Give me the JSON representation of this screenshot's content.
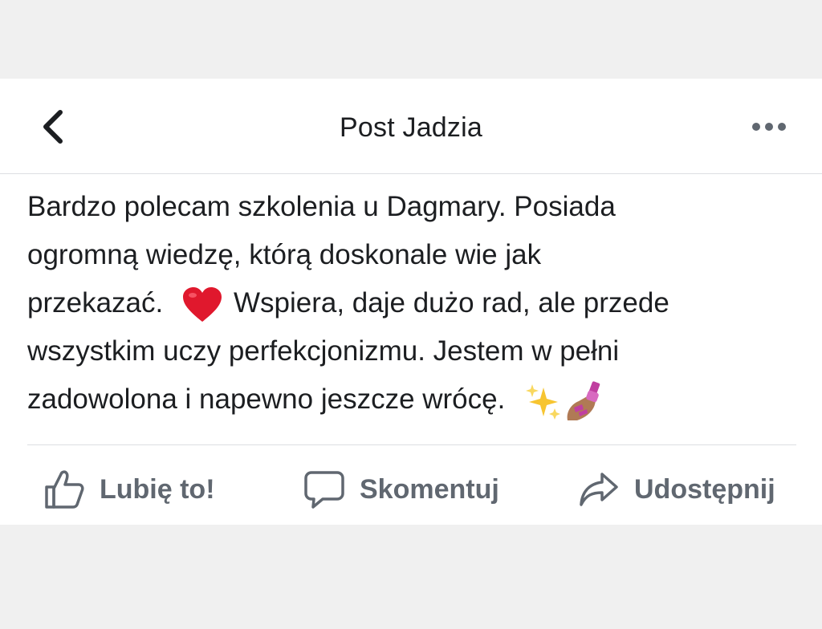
{
  "header": {
    "title": "Post Jadzia",
    "back_icon": "chevron-left-icon",
    "more_icon": "more-horizontal-icon"
  },
  "post": {
    "lines": [
      "Bardzo polecam szkolenia u Dagmary. Posiada",
      "ogromną wiedzę, którą doskonale wie jak",
      "przekazać.",
      "Wspiera, daje dużo rad, ale przede",
      "wszystkim uczy perfekcjonizmu. Jestem w pełni",
      "zadowolona i napewno jeszcze wrócę."
    ],
    "emojis": [
      "red-heart",
      "sparkles",
      "nail-polish"
    ]
  },
  "actions": {
    "like": {
      "label": "Lubię to!",
      "icon": "thumbs-up-icon"
    },
    "comment": {
      "label": "Skomentuj",
      "icon": "comment-icon"
    },
    "share": {
      "label": "Udostępnij",
      "icon": "share-arrow-icon"
    }
  },
  "colors": {
    "background": "#f0f0f0",
    "card": "#ffffff",
    "text": "#1c1e21",
    "secondary_text": "#606770",
    "heart": "#e0182d"
  }
}
